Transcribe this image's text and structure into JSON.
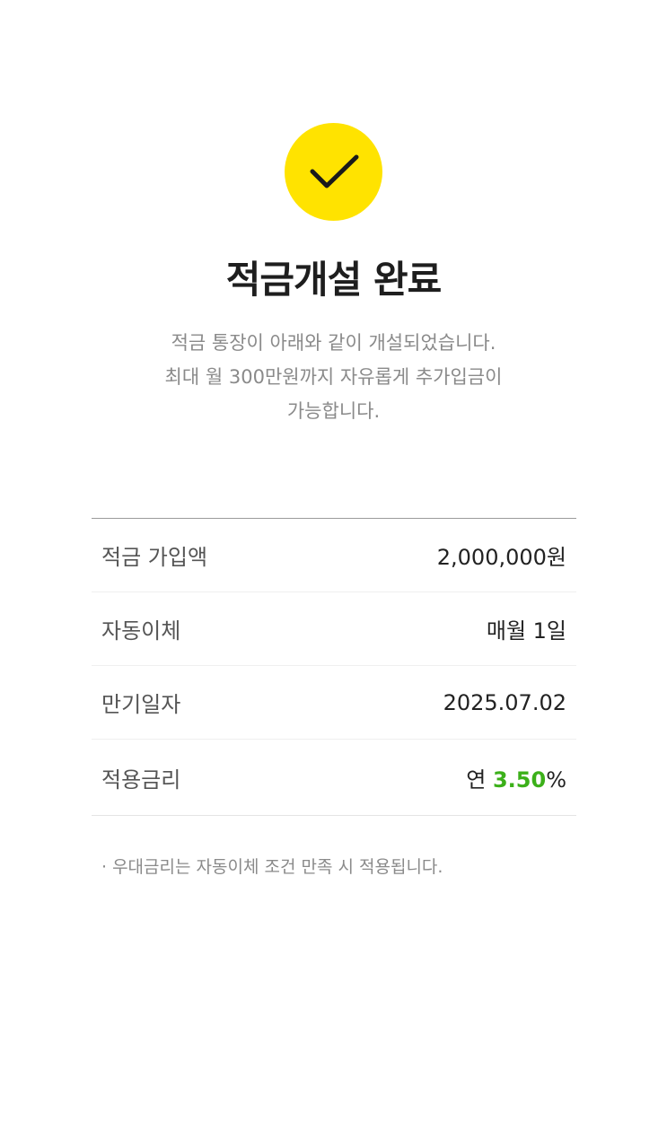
{
  "colors": {
    "accent_yellow": "#FFE300",
    "rate_green": "#3cb01a",
    "text_dark": "#222222",
    "text_gray": "#8a8a8a"
  },
  "icon": "checkmark-icon",
  "header": {
    "title": "적금개설 완료",
    "description_lines": [
      "적금 통장이 아래와 같이 개설되었습니다.",
      "최대 월 300만원까지 자유롭게 추가입금이",
      "가능합니다."
    ]
  },
  "details": {
    "rows": [
      {
        "label": "적금 가입액",
        "value": "2,000,000원"
      },
      {
        "label": "자동이체",
        "value": "매월 1일"
      },
      {
        "label": "만기일자",
        "value": "2025.07.02"
      },
      {
        "label": "적용금리",
        "prefix": "연 ",
        "rate": "3.50",
        "suffix": "%"
      }
    ]
  },
  "notice": "· 우대금리는 자동이체 조건 만족 시 적용됩니다."
}
